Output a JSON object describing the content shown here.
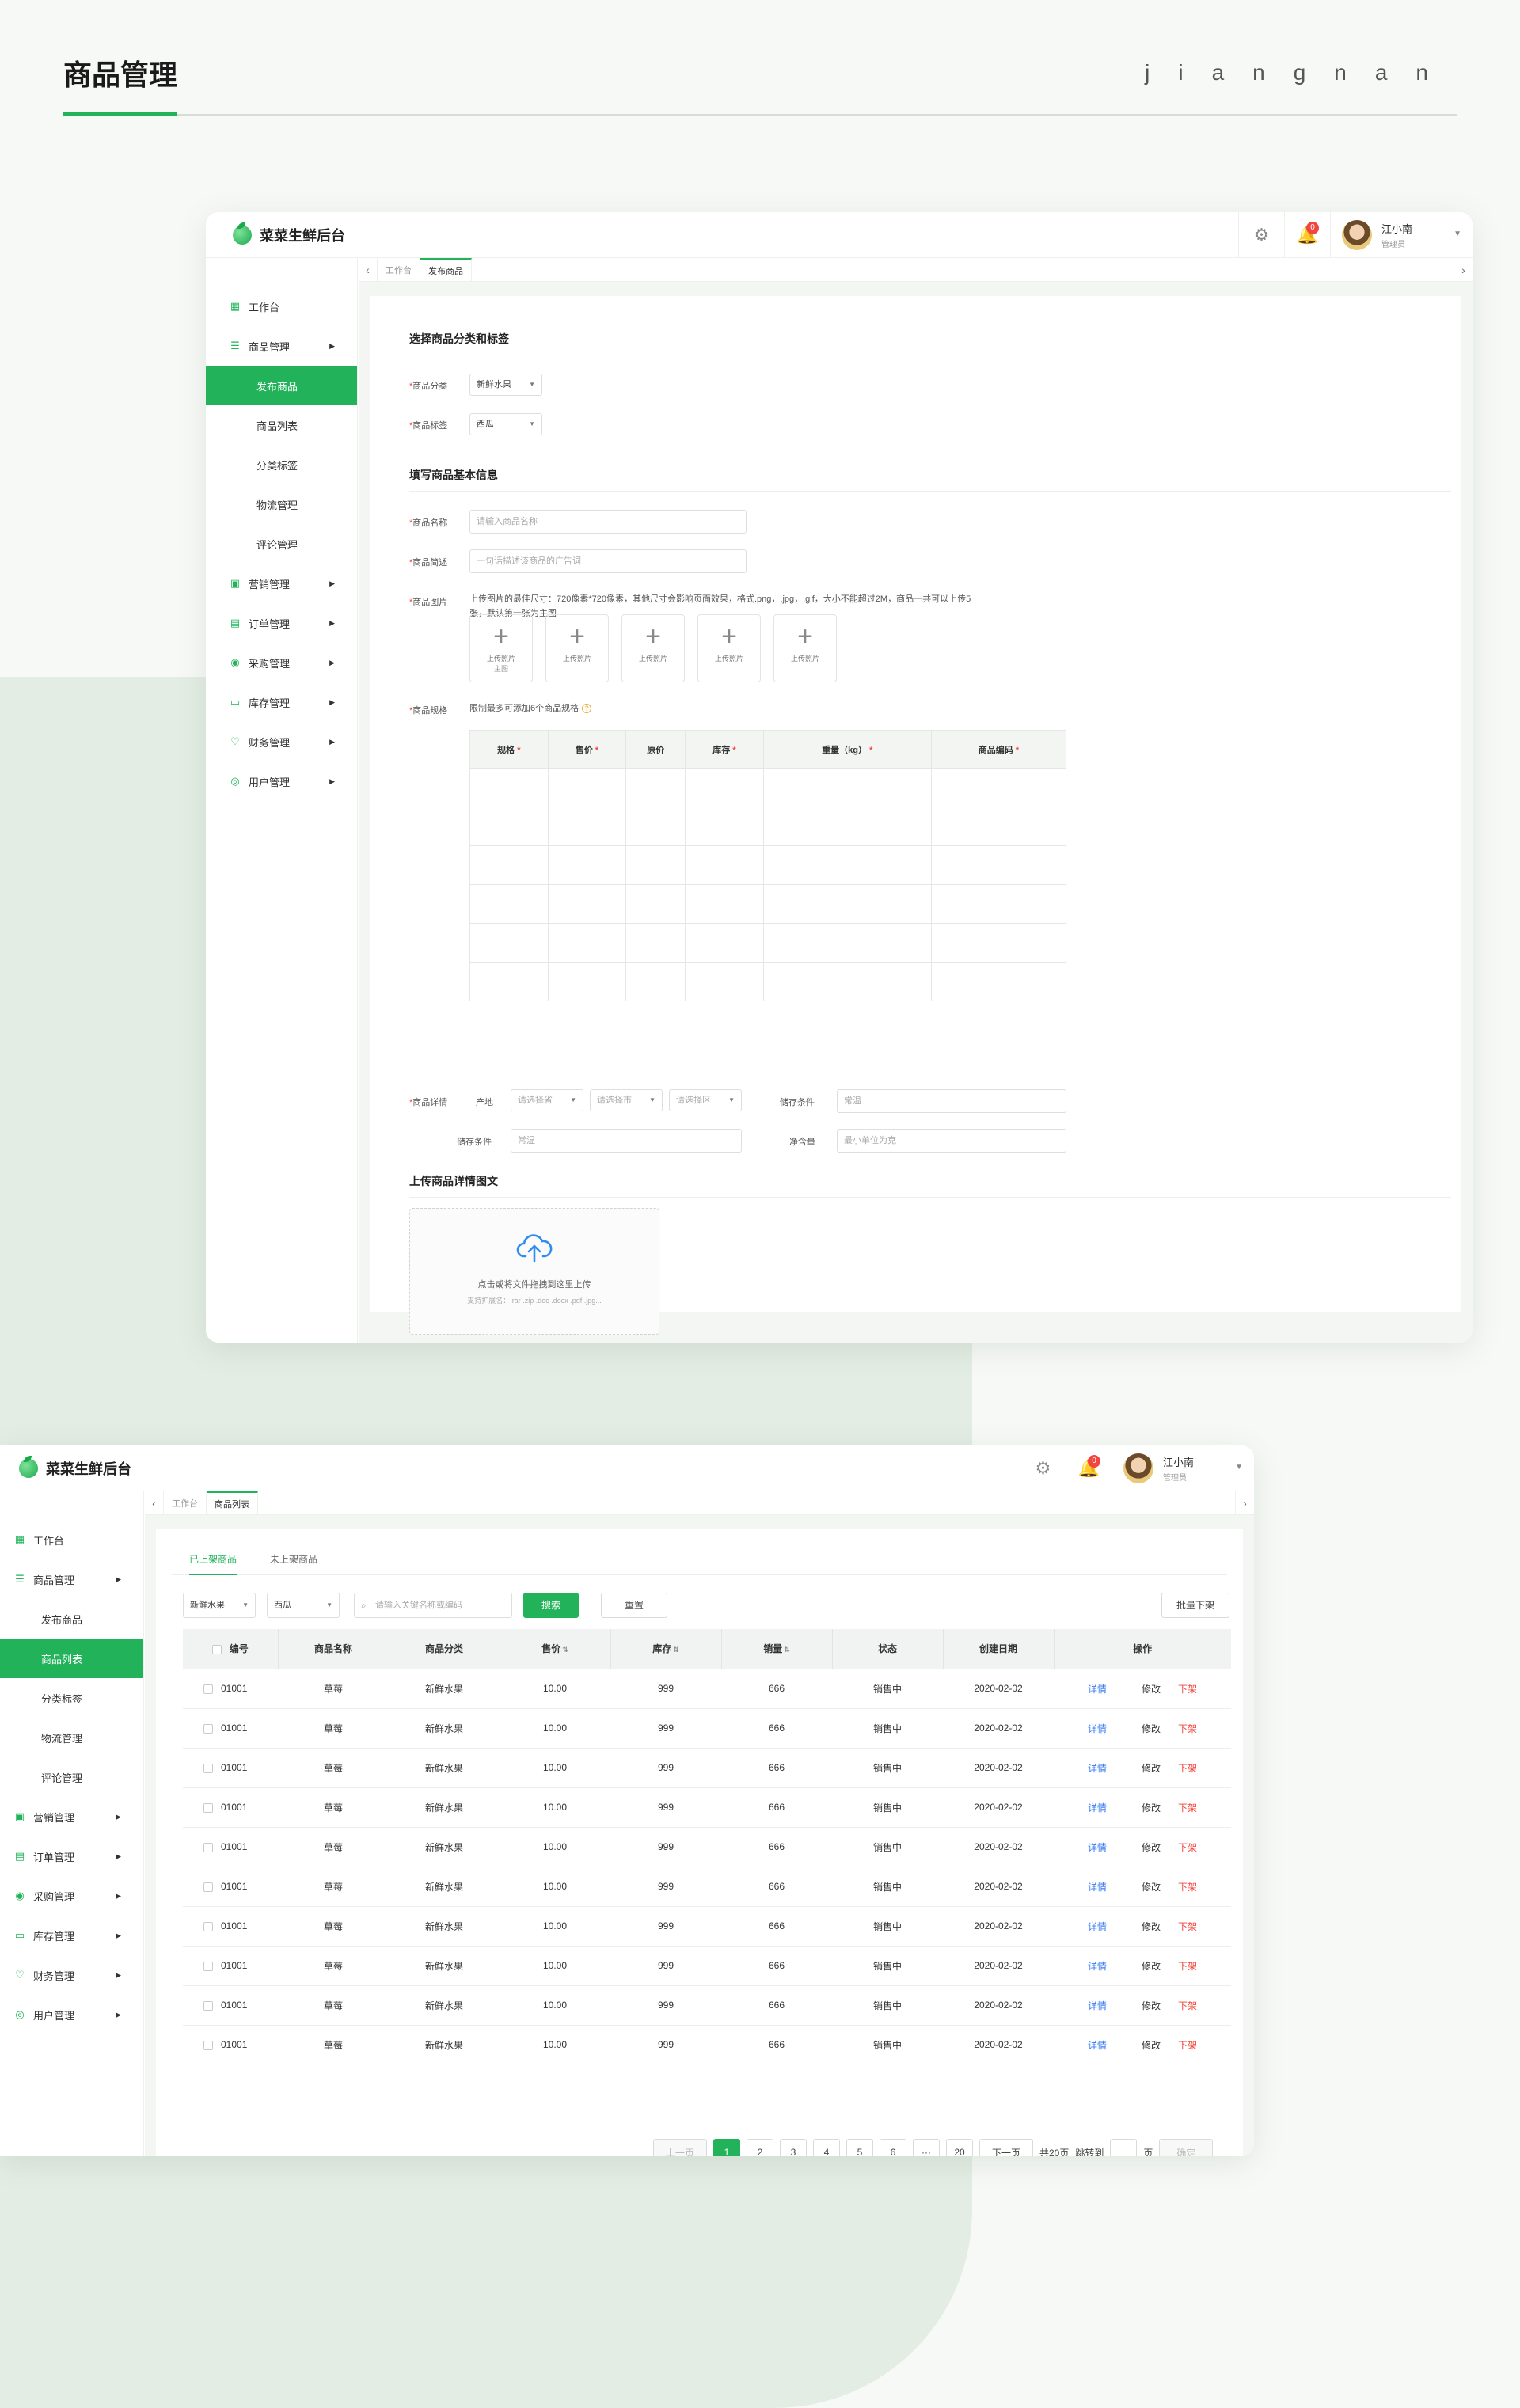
{
  "page": {
    "title": "商品管理",
    "brand": "jiangnan"
  },
  "app": {
    "name": "菜菜生鲜后台",
    "notification_count": "0",
    "user_name": "江小南",
    "user_role": "管理员"
  },
  "sidebar": {
    "items": [
      {
        "label": "工作台"
      },
      {
        "label": "商品管理"
      },
      {
        "label": "发布商品"
      },
      {
        "label": "商品列表"
      },
      {
        "label": "分类标签"
      },
      {
        "label": "物流管理"
      },
      {
        "label": "评论管理"
      },
      {
        "label": "营销管理"
      },
      {
        "label": "订单管理"
      },
      {
        "label": "采购管理"
      },
      {
        "label": "库存管理"
      },
      {
        "label": "财务管理"
      },
      {
        "label": "用户管理"
      }
    ]
  },
  "publish_form": {
    "tabs": [
      "工作台",
      "发布商品"
    ],
    "section1_title": "选择商品分类和标签",
    "category_label": "商品分类",
    "category_value": "新鲜水果",
    "tag_label": "商品标签",
    "tag_value": "西瓜",
    "section2_title": "填写商品基本信息",
    "name_label": "商品名称",
    "name_placeholder": "请输入商品名称",
    "desc_label": "商品简述",
    "desc_placeholder": "一句话描述该商品的广告词",
    "image_label": "商品图片",
    "image_hint_line1": "上传图片的最佳尺寸：720像素*720像素，其他尺寸会影响页面效果，格式.png，.jpg，.gif，大小不能超过2M，商品一共可以上传5",
    "image_hint_line2": "张，默认第一张为主图",
    "upload_label": "上传照片",
    "main_image_label": "主图",
    "spec_label": "商品规格",
    "spec_hint": "限制最多可添加6个商品规格",
    "spec_columns": [
      {
        "label": "规格",
        "required": true
      },
      {
        "label": "售价",
        "required": true
      },
      {
        "label": "原价",
        "required": false
      },
      {
        "label": "库存",
        "required": true
      },
      {
        "label": "重量（kg）",
        "required": true
      },
      {
        "label": "商品编码",
        "required": true
      }
    ],
    "detail_label": "商品详情",
    "origin_label": "产地",
    "province_placeholder": "请选择省",
    "city_placeholder": "请选择市",
    "district_placeholder": "请选择区",
    "storage_label": "储存条件",
    "storage_placeholder": "常温",
    "storage2_label": "储存条件",
    "storage2_placeholder": "常温",
    "net_label": "净含量",
    "net_placeholder": "最小单位为克",
    "section3_title": "上传商品详情图文",
    "drop_main": "点击或将文件拖拽到这里上传",
    "drop_sub": "支持扩展名：.rar .zip .doc .docx .pdf .jpg..."
  },
  "product_list": {
    "tabs": [
      "工作台",
      "商品列表"
    ],
    "status_tabs": [
      "已上架商品",
      "未上架商品"
    ],
    "filter_category": "新鲜水果",
    "filter_tag": "西瓜",
    "search_placeholder": "请输入关键名称或编码",
    "search_button": "搜索",
    "reset_button": "重置",
    "batch_button": "批量下架",
    "columns": [
      "编号",
      "商品名称",
      "商品分类",
      "售价",
      "库存",
      "销量",
      "状态",
      "创建日期",
      "操作"
    ],
    "rows": [
      {
        "id": "01001",
        "name": "草莓",
        "category": "新鲜水果",
        "price": "10.00",
        "stock": "999",
        "sales": "666",
        "status": "销售中",
        "date": "2020-02-02"
      },
      {
        "id": "01001",
        "name": "草莓",
        "category": "新鲜水果",
        "price": "10.00",
        "stock": "999",
        "sales": "666",
        "status": "销售中",
        "date": "2020-02-02"
      },
      {
        "id": "01001",
        "name": "草莓",
        "category": "新鲜水果",
        "price": "10.00",
        "stock": "999",
        "sales": "666",
        "status": "销售中",
        "date": "2020-02-02"
      },
      {
        "id": "01001",
        "name": "草莓",
        "category": "新鲜水果",
        "price": "10.00",
        "stock": "999",
        "sales": "666",
        "status": "销售中",
        "date": "2020-02-02"
      },
      {
        "id": "01001",
        "name": "草莓",
        "category": "新鲜水果",
        "price": "10.00",
        "stock": "999",
        "sales": "666",
        "status": "销售中",
        "date": "2020-02-02"
      },
      {
        "id": "01001",
        "name": "草莓",
        "category": "新鲜水果",
        "price": "10.00",
        "stock": "999",
        "sales": "666",
        "status": "销售中",
        "date": "2020-02-02"
      },
      {
        "id": "01001",
        "name": "草莓",
        "category": "新鲜水果",
        "price": "10.00",
        "stock": "999",
        "sales": "666",
        "status": "销售中",
        "date": "2020-02-02"
      },
      {
        "id": "01001",
        "name": "草莓",
        "category": "新鲜水果",
        "price": "10.00",
        "stock": "999",
        "sales": "666",
        "status": "销售中",
        "date": "2020-02-02"
      },
      {
        "id": "01001",
        "name": "草莓",
        "category": "新鲜水果",
        "price": "10.00",
        "stock": "999",
        "sales": "666",
        "status": "销售中",
        "date": "2020-02-02"
      },
      {
        "id": "01001",
        "name": "草莓",
        "category": "新鲜水果",
        "price": "10.00",
        "stock": "999",
        "sales": "666",
        "status": "销售中",
        "date": "2020-02-02"
      }
    ],
    "actions": {
      "detail": "详情",
      "edit": "修改",
      "off": "下架"
    },
    "pager": {
      "prev": "上一页",
      "pages": [
        "1",
        "2",
        "3",
        "4",
        "5",
        "6",
        "···",
        "20"
      ],
      "next": "下一页",
      "total": "共20页",
      "jump": "跳转到",
      "page_unit": "页",
      "confirm": "确定"
    }
  },
  "colors": {
    "accent": "#22b35a",
    "danger": "#f2453d",
    "link": "#3a7cf0"
  }
}
